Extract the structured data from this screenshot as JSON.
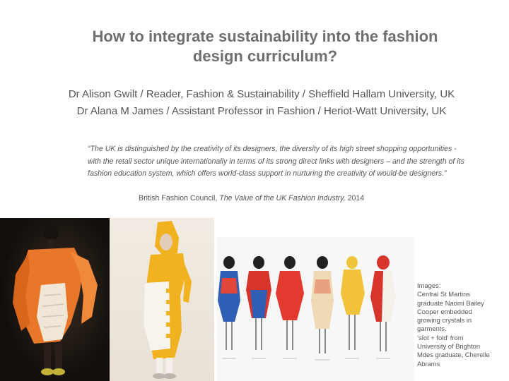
{
  "slide": {
    "title_line1": "How to integrate sustainability into the fashion",
    "title_line2": "design curriculum?",
    "author1": "Dr Alison Gwilt  / Reader, Fashion & Sustainability / Sheffield Hallam University, UK",
    "author2": "Dr Alana M James / Assistant Professor in Fashion / Heriot-Watt University, UK",
    "quote": "“The UK is distinguished by the creativity of its designers, the diversity of its high street shopping opportunities - with the retail sector unique internationally in terms of its strong direct links with designers – and the strength of its fashion education system, which offers world-class support in nurturing the creativity of would-be designers.”",
    "citation_prefix": "British Fashion Council, ",
    "citation_title": "The Value of the UK Fashion Industry,",
    "citation_year": " 2014",
    "caption_lines": [
      "Images:",
      "Central St Martins",
      "graduate Naomi Bailey",
      "Cooper embedded",
      "growing crystals in",
      "garments.",
      "‘slot + fold’ from",
      "University of Brighton",
      "Mdes graduate, Cherelle",
      "Abrams"
    ]
  },
  "colors": {
    "title": "#6f6f6f",
    "text": "#555555",
    "orange_garment": "#e8772a",
    "yellow_garment": "#f0b21e"
  }
}
